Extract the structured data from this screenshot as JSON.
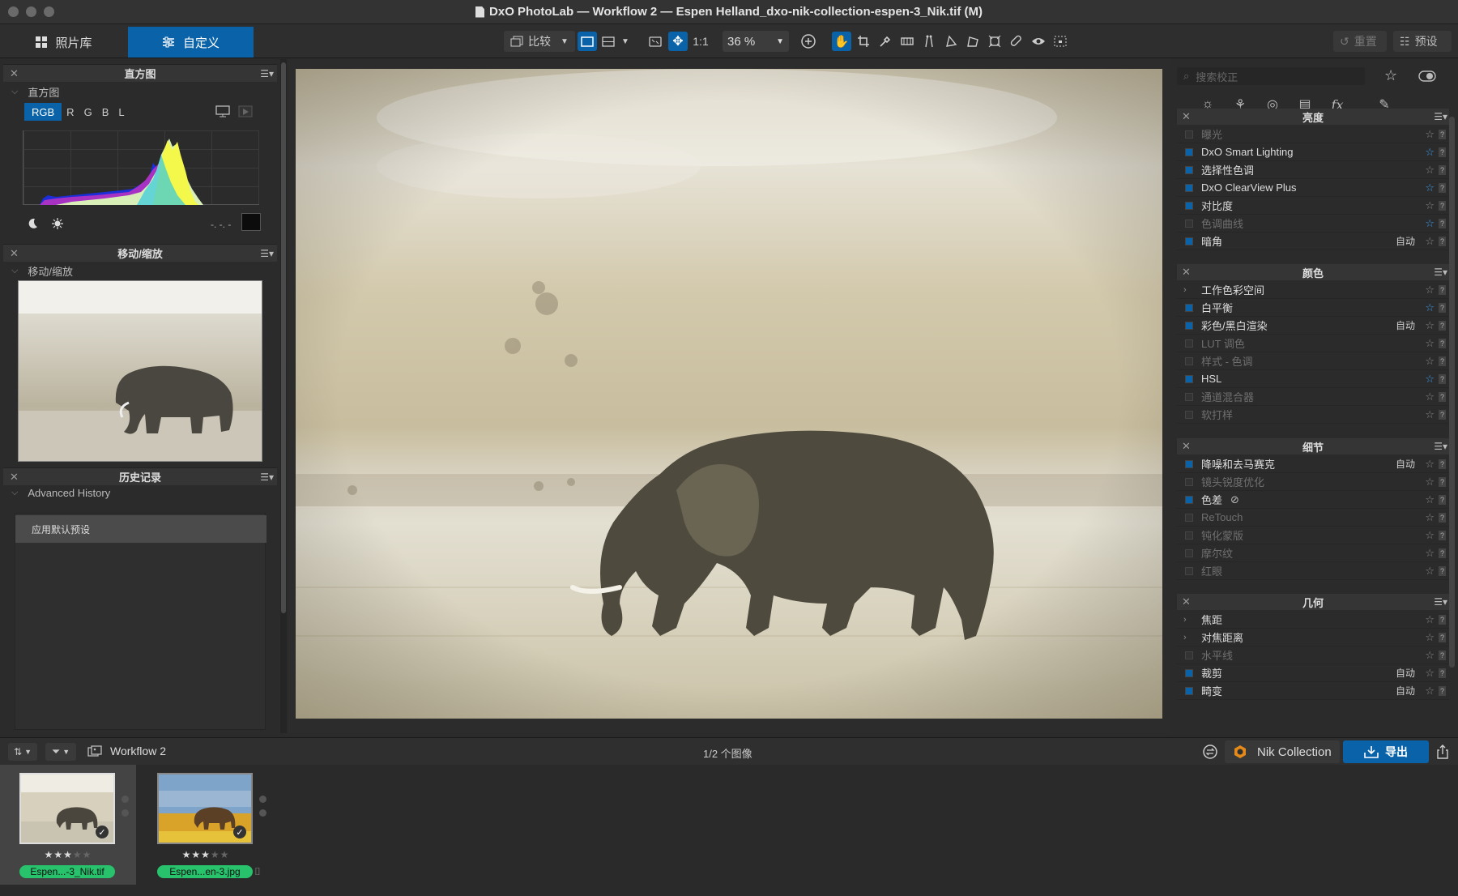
{
  "window": {
    "title": "DxO PhotoLab — Workflow 2 — Espen Helland_dxo-nik-collection-espen-3_Nik.tif (M)"
  },
  "toolbar": {
    "tab_library": "照片库",
    "tab_customize": "自定义",
    "compare_label": "比较",
    "one_to_one": "1:1",
    "zoom_value": "36 %",
    "reset_label": "重置",
    "presets_label": "预设"
  },
  "left_panel": {
    "histogram": {
      "header": "直方图",
      "sub": "直方图",
      "channels": [
        "RGB",
        "R",
        "G",
        "B",
        "L"
      ],
      "readout": "-. -. -"
    },
    "navigator": {
      "header": "移动/缩放",
      "sub": "移动/缩放"
    },
    "history": {
      "header": "历史记录",
      "sub": "Advanced History",
      "items": [
        "应用默认预设"
      ]
    }
  },
  "right_panel": {
    "search_placeholder": "搜索校正",
    "sections": [
      {
        "title": "亮度",
        "rows": [
          {
            "label": "曝光",
            "active": false,
            "auto": "",
            "starred": false
          },
          {
            "label": "DxO Smart Lighting",
            "active": true,
            "auto": "",
            "starred": true
          },
          {
            "label": "选择性色调",
            "active": true,
            "auto": "",
            "starred": false
          },
          {
            "label": "DxO ClearView Plus",
            "active": true,
            "auto": "",
            "starred": true
          },
          {
            "label": "对比度",
            "active": true,
            "auto": "",
            "starred": false
          },
          {
            "label": "色调曲线",
            "active": false,
            "auto": "",
            "starred": true
          },
          {
            "label": "暗角",
            "active": true,
            "auto": "自动",
            "starred": false
          }
        ]
      },
      {
        "title": "颜色",
        "rows": [
          {
            "label": "工作色彩空间",
            "active": true,
            "auto": "",
            "starred": false,
            "expandable": true
          },
          {
            "label": "白平衡",
            "active": true,
            "auto": "",
            "starred": true
          },
          {
            "label": "彩色/黑白渲染",
            "active": true,
            "auto": "自动",
            "starred": false
          },
          {
            "label": "LUT 调色",
            "active": false,
            "auto": "",
            "starred": false
          },
          {
            "label": "样式 - 色调",
            "active": false,
            "auto": "",
            "starred": false
          },
          {
            "label": "HSL",
            "active": true,
            "auto": "",
            "starred": true
          },
          {
            "label": "通道混合器",
            "active": false,
            "auto": "",
            "starred": false
          },
          {
            "label": "软打样",
            "active": false,
            "auto": "",
            "starred": false
          }
        ]
      },
      {
        "title": "细节",
        "rows": [
          {
            "label": "降噪和去马赛克",
            "active": true,
            "auto": "自动",
            "starred": false
          },
          {
            "label": "镜头锐度优化",
            "active": false,
            "auto": "",
            "starred": false
          },
          {
            "label": "色差",
            "active": true,
            "auto": "",
            "starred": false,
            "hidden_icon": true
          },
          {
            "label": "ReTouch",
            "active": false,
            "auto": "",
            "starred": false
          },
          {
            "label": "钝化蒙版",
            "active": false,
            "auto": "",
            "starred": false
          },
          {
            "label": "摩尔纹",
            "active": false,
            "auto": "",
            "starred": false
          },
          {
            "label": "红眼",
            "active": false,
            "auto": "",
            "starred": false
          }
        ]
      },
      {
        "title": "几何",
        "rows": [
          {
            "label": "焦距",
            "active": true,
            "auto": "",
            "starred": false,
            "expandable": true
          },
          {
            "label": "对焦距离",
            "active": true,
            "auto": "",
            "starred": false,
            "expandable": true
          },
          {
            "label": "水平线",
            "active": false,
            "auto": "",
            "starred": false
          },
          {
            "label": "裁剪",
            "active": true,
            "auto": "自动",
            "starred": false
          },
          {
            "label": "畸变",
            "active": true,
            "auto": "自动",
            "starred": false
          }
        ]
      }
    ]
  },
  "bottom_bar": {
    "project_name": "Workflow 2",
    "image_count": "1/2 个图像",
    "nik_label": "Nik Collection",
    "export_label": "导出"
  },
  "filmstrip": [
    {
      "name": "Espen...-3_Nik.tif",
      "stars": "★★★★★",
      "rating": 3,
      "selected": true
    },
    {
      "name": "Espen...en-3.jpg",
      "stars": "★★★★★",
      "rating": 3,
      "selected": false
    }
  ],
  "colors": {
    "accent": "#0a63a8",
    "star_active": "#3b9ae8",
    "filename_badge": "#27c26b"
  }
}
